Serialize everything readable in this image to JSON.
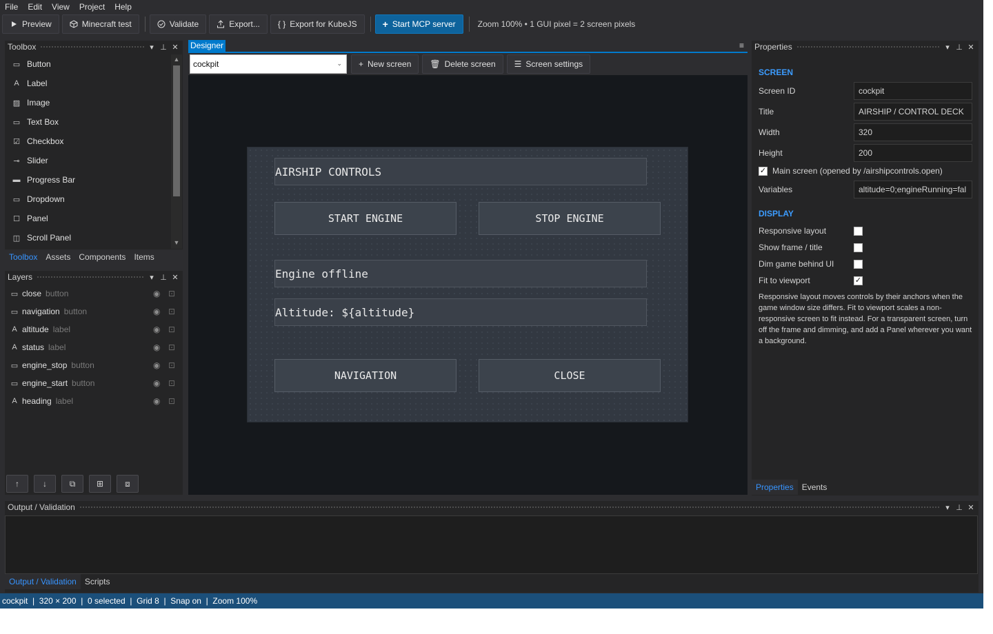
{
  "menu": [
    "File",
    "Edit",
    "View",
    "Project",
    "Help"
  ],
  "toolbar": {
    "preview": "Preview",
    "minecraft_test": "Minecraft test",
    "validate": "Validate",
    "export": "Export...",
    "export_kubejs": "Export for KubeJS",
    "start_mcp": "Start MCP server",
    "zoom_info": "Zoom 100%  •  1 GUI pixel = 2 screen pixels"
  },
  "toolbox": {
    "title": "Toolbox",
    "items": [
      {
        "label": "Button",
        "icon": "button-icon"
      },
      {
        "label": "Label",
        "icon": "label-icon"
      },
      {
        "label": "Image",
        "icon": "image-icon"
      },
      {
        "label": "Text Box",
        "icon": "textbox-icon"
      },
      {
        "label": "Checkbox",
        "icon": "checkbox-icon"
      },
      {
        "label": "Slider",
        "icon": "slider-icon"
      },
      {
        "label": "Progress Bar",
        "icon": "progressbar-icon"
      },
      {
        "label": "Dropdown",
        "icon": "dropdown-icon"
      },
      {
        "label": "Panel",
        "icon": "panel-icon"
      },
      {
        "label": "Scroll Panel",
        "icon": "scrollpanel-icon"
      }
    ],
    "tabs": [
      "Toolbox",
      "Assets",
      "Components",
      "Items"
    ]
  },
  "layers": {
    "title": "Layers",
    "items": [
      {
        "name": "close",
        "type": "button"
      },
      {
        "name": "navigation",
        "type": "button"
      },
      {
        "name": "altitude",
        "type": "label"
      },
      {
        "name": "status",
        "type": "label"
      },
      {
        "name": "engine_stop",
        "type": "button"
      },
      {
        "name": "engine_start",
        "type": "button"
      },
      {
        "name": "heading",
        "type": "label"
      }
    ]
  },
  "designer": {
    "tab": "Designer",
    "screen": "cockpit",
    "new_screen": "New screen",
    "delete_screen": "Delete screen",
    "screen_settings": "Screen settings"
  },
  "gui": {
    "heading": "AIRSHIP CONTROLS",
    "start_engine": "START ENGINE",
    "stop_engine": "STOP ENGINE",
    "status": "Engine offline",
    "altitude": "Altitude: ${altitude}",
    "navigation": "NAVIGATION",
    "close": "CLOSE"
  },
  "properties": {
    "title": "Properties",
    "screen_section": "SCREEN",
    "screen_id_label": "Screen ID",
    "screen_id": "cockpit",
    "title_label": "Title",
    "title_value": "AIRSHIP / CONTROL DECK",
    "width_label": "Width",
    "width": "320",
    "height_label": "Height",
    "height": "200",
    "main_screen_label": "Main screen (opened by /airshipcontrols.open)",
    "main_screen": true,
    "variables_label": "Variables",
    "variables": "altitude=0;engineRunning=fal",
    "display_section": "DISPLAY",
    "responsive_label": "Responsive layout",
    "responsive": false,
    "show_frame_label": "Show frame / title",
    "show_frame": false,
    "dim_label": "Dim game behind UI",
    "dim": false,
    "fit_label": "Fit to viewport",
    "fit": true,
    "help": "Responsive layout moves controls by their anchors when the game window size differs. Fit to viewport scales a non-responsive screen to fit instead. For a transparent screen, turn off the frame and dimming, and add a Panel wherever you want a background.",
    "tabs": [
      "Properties",
      "Events"
    ]
  },
  "output": {
    "title": "Output / Validation",
    "tabs": [
      "Output / Validation",
      "Scripts"
    ]
  },
  "status": "cockpit  |  320 × 200  |  0 selected  |  Grid 8  |  Snap on  |  Zoom 100%",
  "colors": {
    "accent": "#007acc",
    "link": "#3794ff",
    "statusbar": "#1b4f7a",
    "primary_button": "#0e639c"
  }
}
